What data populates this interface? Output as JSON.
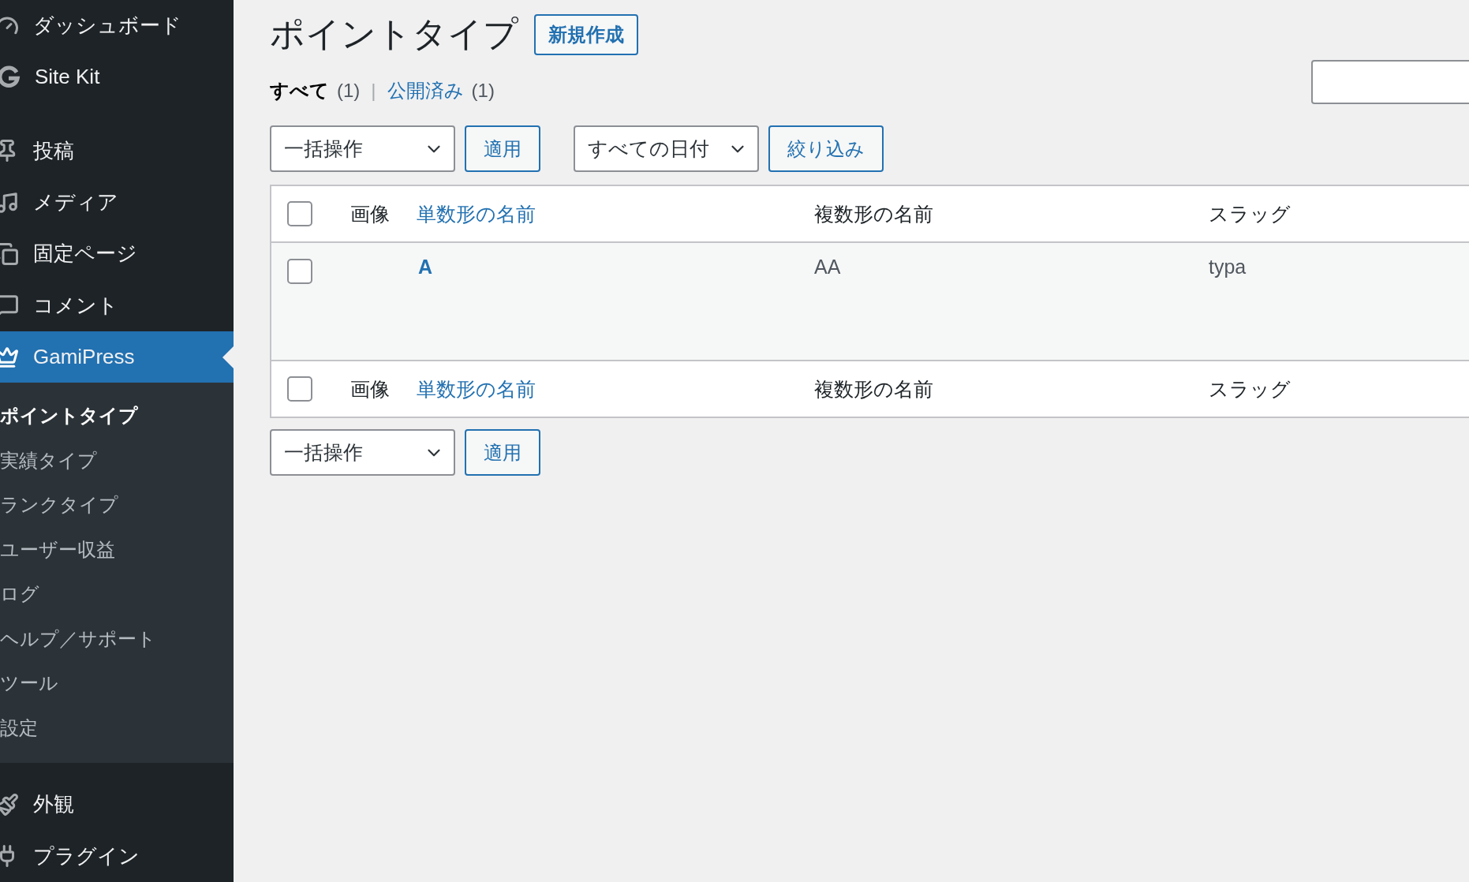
{
  "sidebar": {
    "menu": [
      {
        "label": "ダッシュボード",
        "selected": false
      },
      {
        "label": "Site Kit",
        "selected": false
      },
      {
        "label": "投稿",
        "selected": false
      },
      {
        "label": "メディア",
        "selected": false
      },
      {
        "label": "固定ページ",
        "selected": false
      },
      {
        "label": "コメント",
        "selected": false
      },
      {
        "label": "GamiPress",
        "selected": true,
        "children": [
          {
            "label": "ポイントタイプ",
            "selected": true
          },
          {
            "label": "実績タイプ",
            "selected": false
          },
          {
            "label": "ランクタイプ",
            "selected": false
          },
          {
            "label": "ユーザー収益",
            "selected": false
          },
          {
            "label": "ログ",
            "selected": false
          },
          {
            "label": "ヘルプ／サポート",
            "selected": false
          },
          {
            "label": "ツール",
            "selected": false
          },
          {
            "label": "設定",
            "selected": false
          }
        ]
      },
      {
        "label": "外観",
        "selected": false
      },
      {
        "label": "プラグイン",
        "selected": false
      }
    ]
  },
  "page": {
    "title": "ポイントタイプ",
    "add_new": "新規作成"
  },
  "views": [
    {
      "label": "すべて",
      "count": "(1)",
      "selected": true
    },
    {
      "label": "公開済み",
      "count": "(1)",
      "selected": false
    }
  ],
  "views_separator": "|",
  "top_nav": {
    "bulk_action": "一括操作",
    "apply": "適用",
    "date_filter": "すべての日付",
    "filter": "絞り込み"
  },
  "table": {
    "select_all_checked": false,
    "columns": [
      {
        "label": "画像",
        "sortable": false
      },
      {
        "label": "単数形の名前",
        "sortable": true
      },
      {
        "label": "複数形の名前",
        "sortable": false
      },
      {
        "label": "スラッグ",
        "sortable": false
      }
    ],
    "rows": [
      {
        "selected": false,
        "singular": "A",
        "plural": "AA",
        "slug": "typa"
      }
    ],
    "footer_columns": [
      {
        "label": "画像",
        "sortable": false
      },
      {
        "label": "単数形の名前",
        "sortable": true
      },
      {
        "label": "複数形の名前",
        "sortable": false
      },
      {
        "label": "スラッグ",
        "sortable": false
      }
    ],
    "footer_select_all_checked": false
  },
  "bottom_nav": {
    "bulk_action": "一括操作",
    "apply": "適用"
  }
}
